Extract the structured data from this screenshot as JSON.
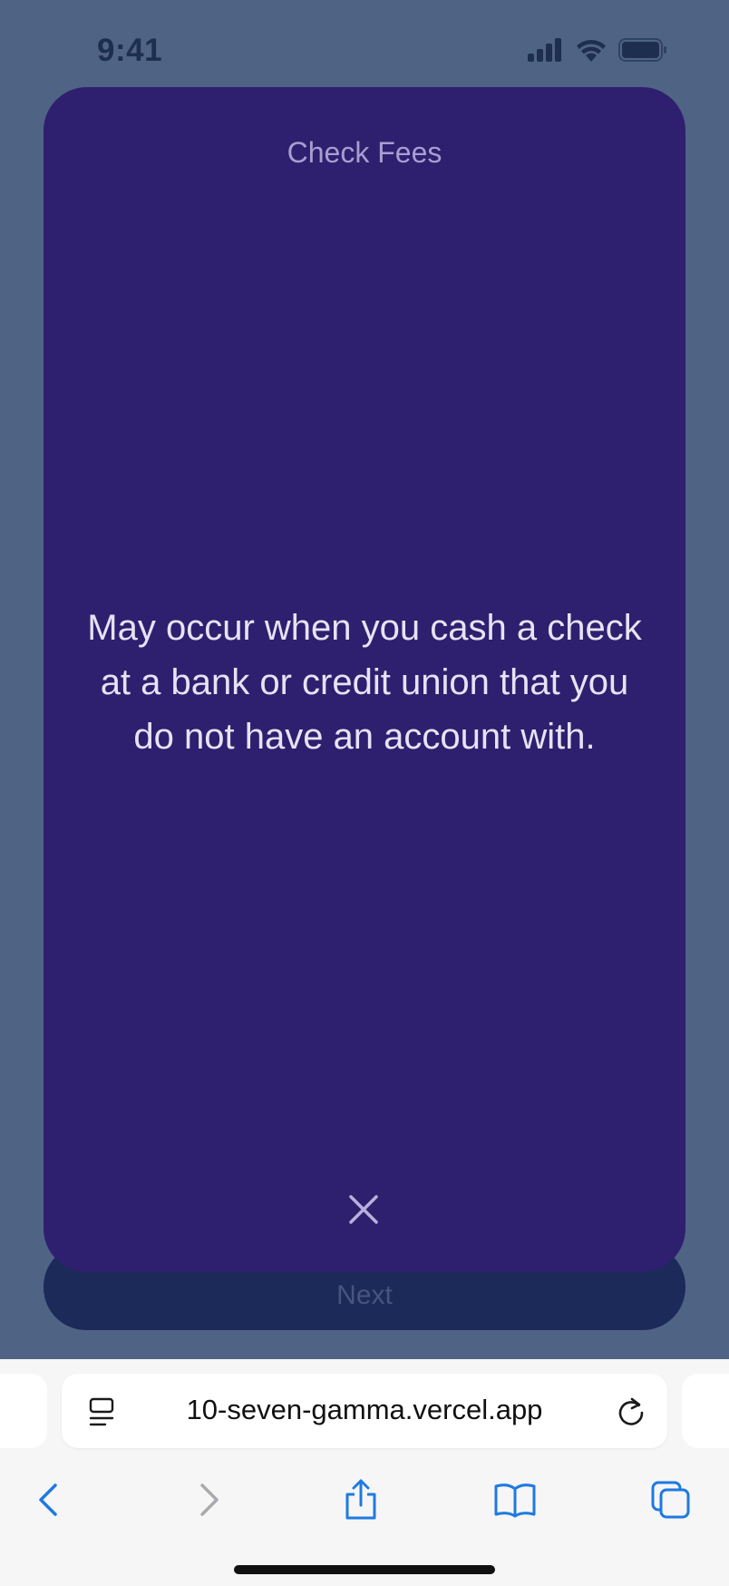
{
  "status_bar": {
    "time": "9:41",
    "icons": [
      "cellular-signal-icon",
      "wifi-icon",
      "battery-icon"
    ]
  },
  "modal": {
    "title": "Check Fees",
    "body": "May occur when you cash a check at a bank or credit union that you do not have an account with.",
    "close_icon": "close-icon"
  },
  "next_button": {
    "label": "Next"
  },
  "browser": {
    "url": "10-seven-gamma.vercel.app",
    "toolbar": [
      "back-icon",
      "forward-icon",
      "share-icon",
      "bookmarks-icon",
      "tabs-icon"
    ]
  },
  "colors": {
    "background": "#4f6384",
    "modal": "#2e1f6f",
    "next_button": "#1c2a5a",
    "accent_blue": "#1f7ae0"
  }
}
